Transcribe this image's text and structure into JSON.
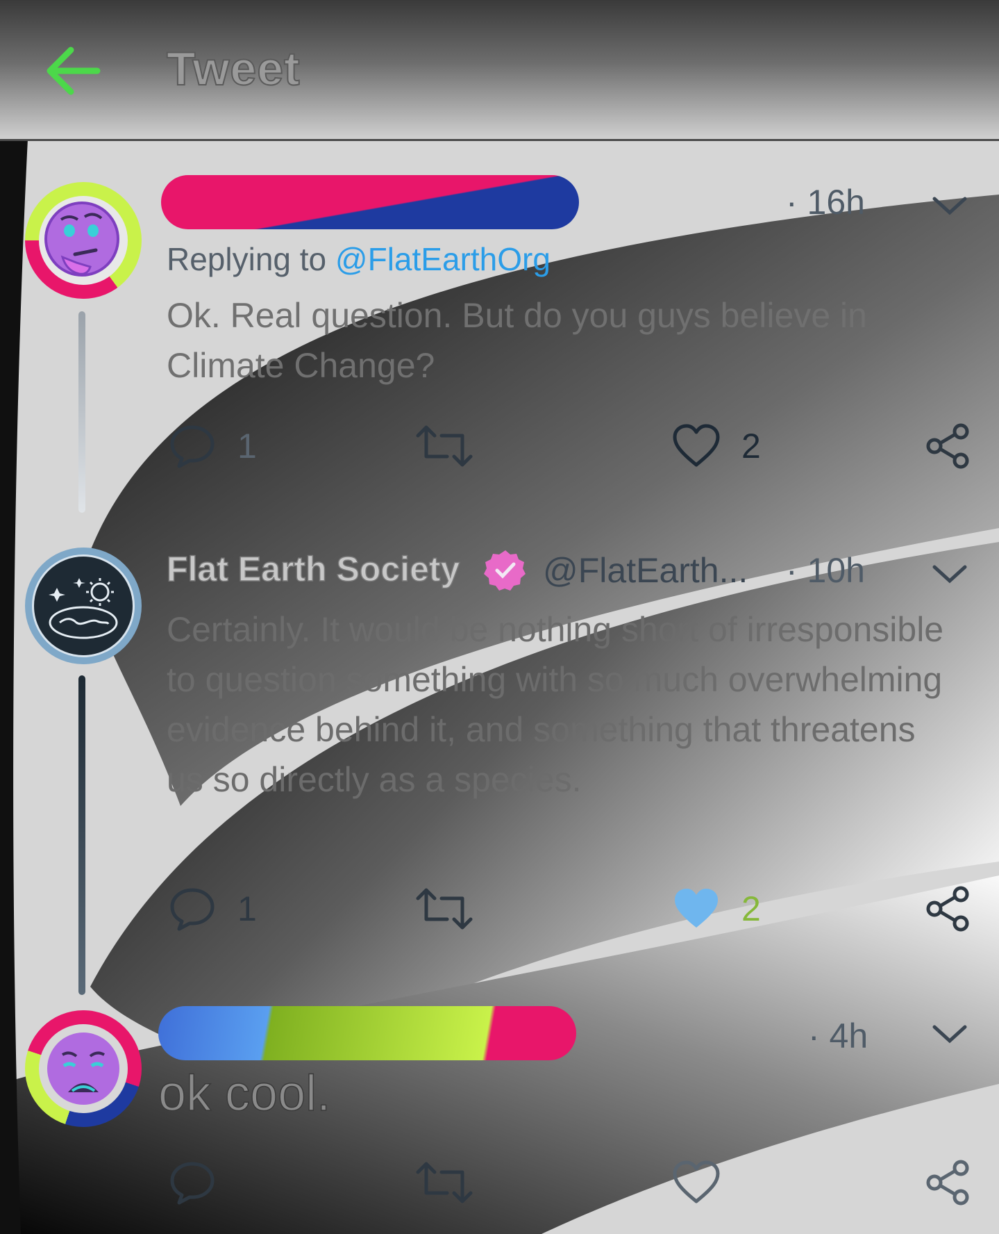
{
  "header": {
    "title": "Tweet",
    "back_icon": "arrow-left-icon",
    "accent": "#4cd84a"
  },
  "tweets": [
    {
      "avatar_icon": "thinking-face-emoji",
      "time": "· 16h",
      "replying_prefix": "Replying to",
      "replying_to": "@FlatEarthOrg",
      "text": "Ok. Real question. But do you guys believe in Climate Change?",
      "actions": {
        "reply_count": "1",
        "retweet_count": "",
        "like_count": "2"
      }
    },
    {
      "avatar_icon": "flat-earth-logo",
      "name": "Flat Earth Society",
      "verified_icon": "verified-badge-icon",
      "handle": "@FlatEarth...",
      "time": "· 10h",
      "text": "Certainly. It would be nothing short of irresponsible to question something with so much overwhelming evidence behind it, and something that threatens us so directly as a species.",
      "actions": {
        "reply_count": "1",
        "retweet_count": "",
        "like_count": "2",
        "liked": true
      }
    },
    {
      "avatar_icon": "anguished-face-emoji",
      "time": "· 4h",
      "text": "ok cool.",
      "actions": {
        "reply_count": "",
        "retweet_count": "",
        "like_count": ""
      }
    }
  ],
  "colors": {
    "like_active": "#6fb6ee",
    "mention": "#2b9de8",
    "icon_stroke": "#2e3842"
  }
}
